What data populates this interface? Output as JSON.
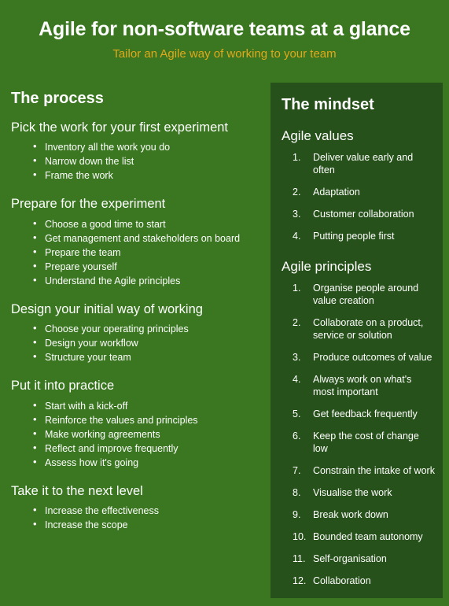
{
  "header": {
    "title": "Agile for non-software teams at a glance",
    "subtitle": "Tailor an Agile way of working to your team",
    "title_color": "#ffffff",
    "subtitle_color": "#e3a81c",
    "background_color": "#3a7720"
  },
  "theme": {
    "page_background": "#3a7720",
    "panel_background": "#27511a",
    "text_color": "#ffffff",
    "accent_color": "#e3a81c"
  },
  "left_column": {
    "title": "The process",
    "sections": [
      {
        "heading": "Pick the work for your first experiment",
        "items": [
          "Inventory all the work you do",
          "Narrow down the list",
          "Frame the work"
        ]
      },
      {
        "heading": "Prepare for the experiment",
        "items": [
          "Choose a good time to start",
          "Get management and stakeholders on board",
          "Prepare the team",
          "Prepare yourself",
          "Understand the Agile principles"
        ]
      },
      {
        "heading": "Design your initial way of working",
        "items": [
          "Choose your operating principles",
          "Design your workflow",
          "Structure your team"
        ]
      },
      {
        "heading": "Put it into practice",
        "items": [
          "Start with a kick-off",
          "Reinforce the values and principles",
          "Make working agreements",
          "Reflect and improve frequently",
          "Assess how it's going"
        ]
      },
      {
        "heading": "Take it to the next level",
        "items": [
          "Increase the effectiveness",
          "Increase the scope"
        ]
      }
    ]
  },
  "right_column": {
    "title": "The mindset",
    "groups": [
      {
        "heading": "Agile values",
        "items": [
          {
            "num": "1.",
            "text": "Deliver value early and often"
          },
          {
            "num": "2.",
            "text": "Adaptation"
          },
          {
            "num": "3.",
            "text": "Customer collaboration"
          },
          {
            "num": "4.",
            "text": "Putting people first"
          }
        ]
      },
      {
        "heading": "Agile principles",
        "items": [
          {
            "num": "1.",
            "text": "Organise people around value creation"
          },
          {
            "num": "2.",
            "text": "Collaborate on a product, service or solution"
          },
          {
            "num": "3.",
            "text": "Produce outcomes of value"
          },
          {
            "num": "4.",
            "text": "Always work on what's most important"
          },
          {
            "num": "5.",
            "text": "Get feedback frequently"
          },
          {
            "num": "6.",
            "text": "Keep the cost of change low"
          },
          {
            "num": "7.",
            "text": "Constrain the intake of work"
          },
          {
            "num": "8.",
            "text": "Visualise the work"
          },
          {
            "num": "9.",
            "text": "Break work down"
          },
          {
            "num": "10.",
            "text": "Bounded team autonomy"
          },
          {
            "num": "11.",
            "text": "Self-organisation"
          },
          {
            "num": "12.",
            "text": "Collaboration"
          }
        ]
      }
    ]
  }
}
